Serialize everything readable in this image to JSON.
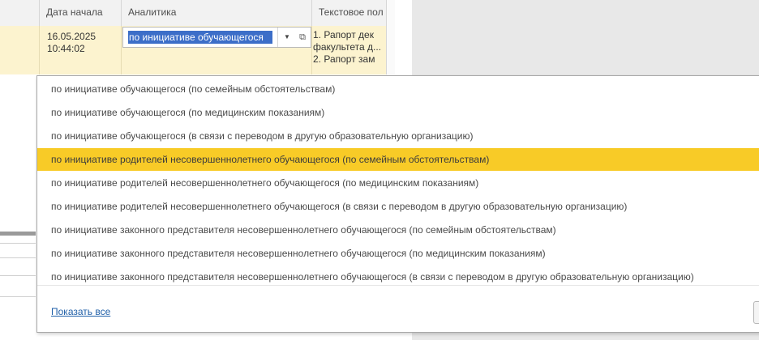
{
  "table": {
    "columns": [
      "",
      "Дата начала",
      "Аналитика",
      "Текстовое пол"
    ],
    "row": {
      "date": "16.05.2025",
      "time": "10:44:02",
      "analytics_value": "по инициативе обучающегося",
      "text_lines": [
        "1.  Рапорт дек",
        "факультета д...",
        "2.  Рапорт зам"
      ]
    }
  },
  "icons": {
    "dropdown": "dropdown-arrow-icon",
    "open": "open-form-icon"
  },
  "popup": {
    "items": [
      "по инициативе обучающегося (по семейным обстоятельствам)",
      "по инициативе обучающегося (по медицинским показаниям)",
      "по инициативе обучающегося (в связи с переводом в другую образовательную организацию)",
      "по инициативе родителей несовершеннолетнего обучающегося (по семейным обстоятельствам)",
      "по инициативе родителей несовершеннолетнего обучающегося (по медицинским показаниям)",
      "по инициативе родителей несовершеннолетнего обучающегося (в связи с переводом в другую образовательную организацию)",
      "по инициативе законного представителя несовершеннолетнего обучающегося (по семейным обстоятельствам)",
      "по инициативе законного представителя несовершеннолетнего обучающегося (по медицинским показаниям)",
      "по инициативе законного представителя несовершеннолетнего обучающегося (в связи с переводом в другую образовательную организацию)"
    ],
    "selected_index": 3,
    "show_all_label": "Показать все"
  },
  "colors": {
    "selected_item": "#f8cb27",
    "row_highlight": "#fcf3cf",
    "input_selection": "#3c6ec8",
    "link": "#1f5fa8"
  }
}
